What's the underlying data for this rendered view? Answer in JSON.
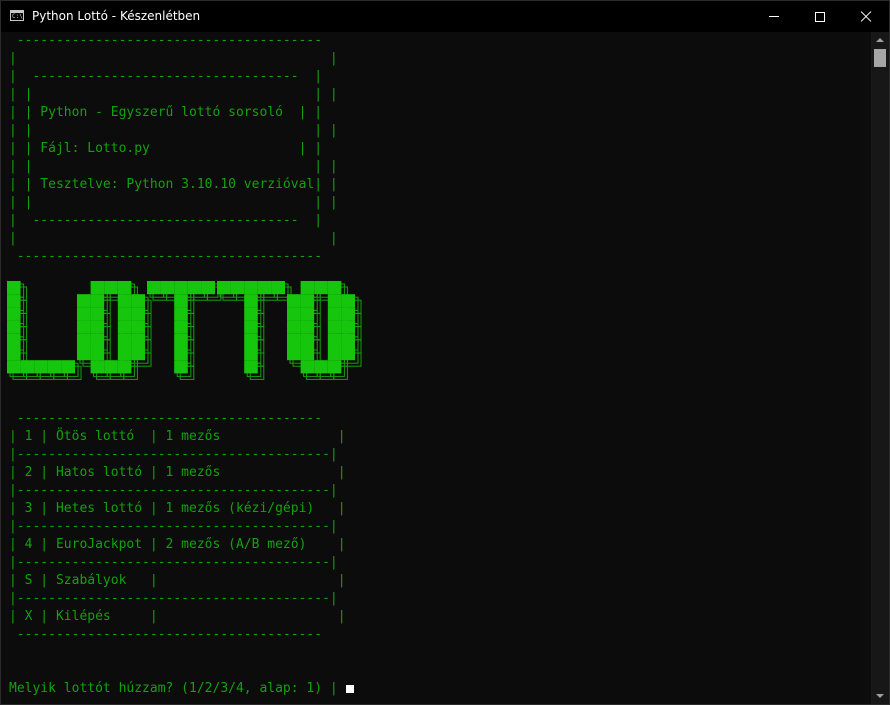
{
  "window": {
    "title": "Python Lottó - Készenlétben",
    "icon": "console-app-icon",
    "controls": [
      "minimize-icon",
      "maximize-icon",
      "close-icon"
    ]
  },
  "colors": {
    "console_bg": "#0c0c0c",
    "text_green": "#13a10e",
    "logo_green": "#16c60c",
    "titlebar_bg": "#000000",
    "cursor": "#ffffff"
  },
  "header_box": {
    "line1": "Python - Egyszerű lottó sorsoló",
    "line2": "Fájl: Lotto.py",
    "line3": "Tesztelve: Python 3.10.10 verzióval"
  },
  "logo_text": "LOTTO",
  "menu": [
    {
      "key": "1",
      "name": "Ötös lottó",
      "info": "1 mezős"
    },
    {
      "key": "2",
      "name": "Hatos lottó",
      "info": "1 mezős"
    },
    {
      "key": "3",
      "name": "Hetes lottó",
      "info": "1 mezős (kézi/gépi)"
    },
    {
      "key": "4",
      "name": "EuroJackpot",
      "info": "2 mezős (A/B mező)"
    },
    {
      "key": "S",
      "name": "Szabályok",
      "info": ""
    },
    {
      "key": "X",
      "name": "Kilépés",
      "info": ""
    }
  ],
  "prompt": "Melyik lottót húzzam? (1/2/3/4, alap: 1) |"
}
